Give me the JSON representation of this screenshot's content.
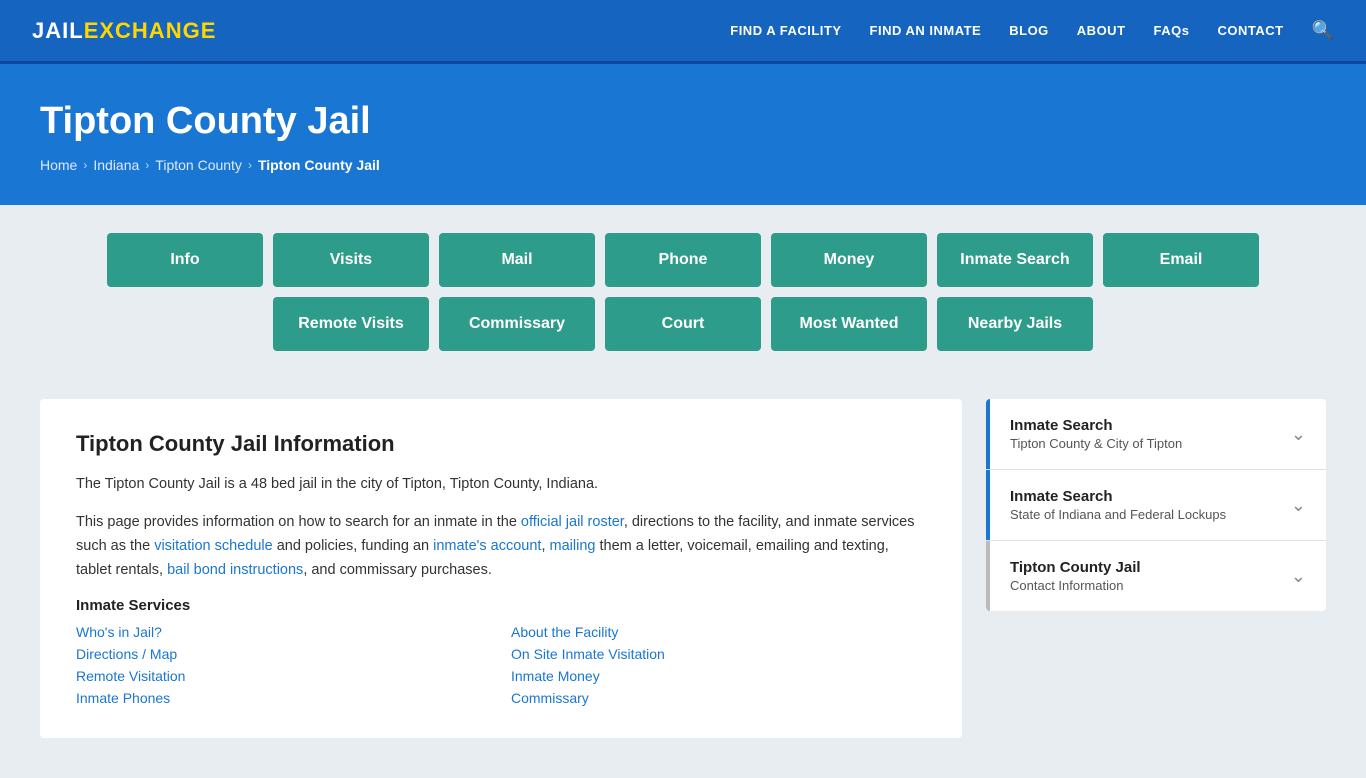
{
  "header": {
    "logo_jail": "JAIL",
    "logo_exchange": "EXCHANGE",
    "nav": [
      {
        "label": "FIND A FACILITY",
        "name": "find-a-facility"
      },
      {
        "label": "FIND AN INMATE",
        "name": "find-an-inmate"
      },
      {
        "label": "BLOG",
        "name": "blog"
      },
      {
        "label": "ABOUT",
        "name": "about"
      },
      {
        "label": "FAQs",
        "name": "faqs"
      },
      {
        "label": "CONTACT",
        "name": "contact"
      }
    ]
  },
  "hero": {
    "title": "Tipton County Jail",
    "breadcrumbs": [
      {
        "label": "Home",
        "name": "breadcrumb-home"
      },
      {
        "label": "Indiana",
        "name": "breadcrumb-indiana"
      },
      {
        "label": "Tipton County",
        "name": "breadcrumb-tipton-county"
      },
      {
        "label": "Tipton County Jail",
        "name": "breadcrumb-tipton-jail",
        "current": true
      }
    ]
  },
  "buttons_row1": [
    {
      "label": "Info",
      "name": "btn-info"
    },
    {
      "label": "Visits",
      "name": "btn-visits"
    },
    {
      "label": "Mail",
      "name": "btn-mail"
    },
    {
      "label": "Phone",
      "name": "btn-phone"
    },
    {
      "label": "Money",
      "name": "btn-money"
    },
    {
      "label": "Inmate Search",
      "name": "btn-inmate-search"
    },
    {
      "label": "Email",
      "name": "btn-email"
    }
  ],
  "buttons_row2": [
    {
      "label": "Remote Visits",
      "name": "btn-remote-visits"
    },
    {
      "label": "Commissary",
      "name": "btn-commissary"
    },
    {
      "label": "Court",
      "name": "btn-court"
    },
    {
      "label": "Most Wanted",
      "name": "btn-most-wanted"
    },
    {
      "label": "Nearby Jails",
      "name": "btn-nearby-jails"
    }
  ],
  "info": {
    "title": "Tipton County Jail Information",
    "para1": "The Tipton County Jail is a 48 bed jail in the city of Tipton, Tipton County, Indiana.",
    "para2_before_link1": "This page provides information on how to search for an inmate in the ",
    "para2_link1": "official jail roster",
    "para2_between1_2": ", directions to the facility, and inmate services such as the ",
    "para2_link2": "visitation schedule",
    "para2_between2_3": " and policies, funding an ",
    "para2_link3": "inmate's account",
    "para2_between3_4": ", ",
    "para2_link4": "mailing",
    "para2_after4": " them a letter, voicemail, emailing and texting, tablet rentals, ",
    "para2_link5": "bail bond instructions",
    "para2_end": ", and commissary purchases.",
    "services_title": "Inmate Services",
    "services": [
      {
        "label": "Who's in Jail?",
        "col": 0
      },
      {
        "label": "About the Facility",
        "col": 1
      },
      {
        "label": "Directions / Map",
        "col": 0
      },
      {
        "label": "On Site Inmate Visitation",
        "col": 1
      },
      {
        "label": "Remote Visitation",
        "col": 0
      },
      {
        "label": "Inmate Money",
        "col": 1
      },
      {
        "label": "Inmate Phones",
        "col": 0
      },
      {
        "label": "Commissary",
        "col": 1
      }
    ]
  },
  "accordion": [
    {
      "label": "Inmate Search",
      "sub": "Tipton County & City of Tipton",
      "name": "accordion-inmate-search-county",
      "active": true
    },
    {
      "label": "Inmate Search",
      "sub": "State of Indiana and Federal Lockups",
      "name": "accordion-inmate-search-state",
      "active": true
    },
    {
      "label": "Tipton County Jail",
      "sub": "Contact Information",
      "name": "accordion-contact",
      "active": false
    }
  ]
}
